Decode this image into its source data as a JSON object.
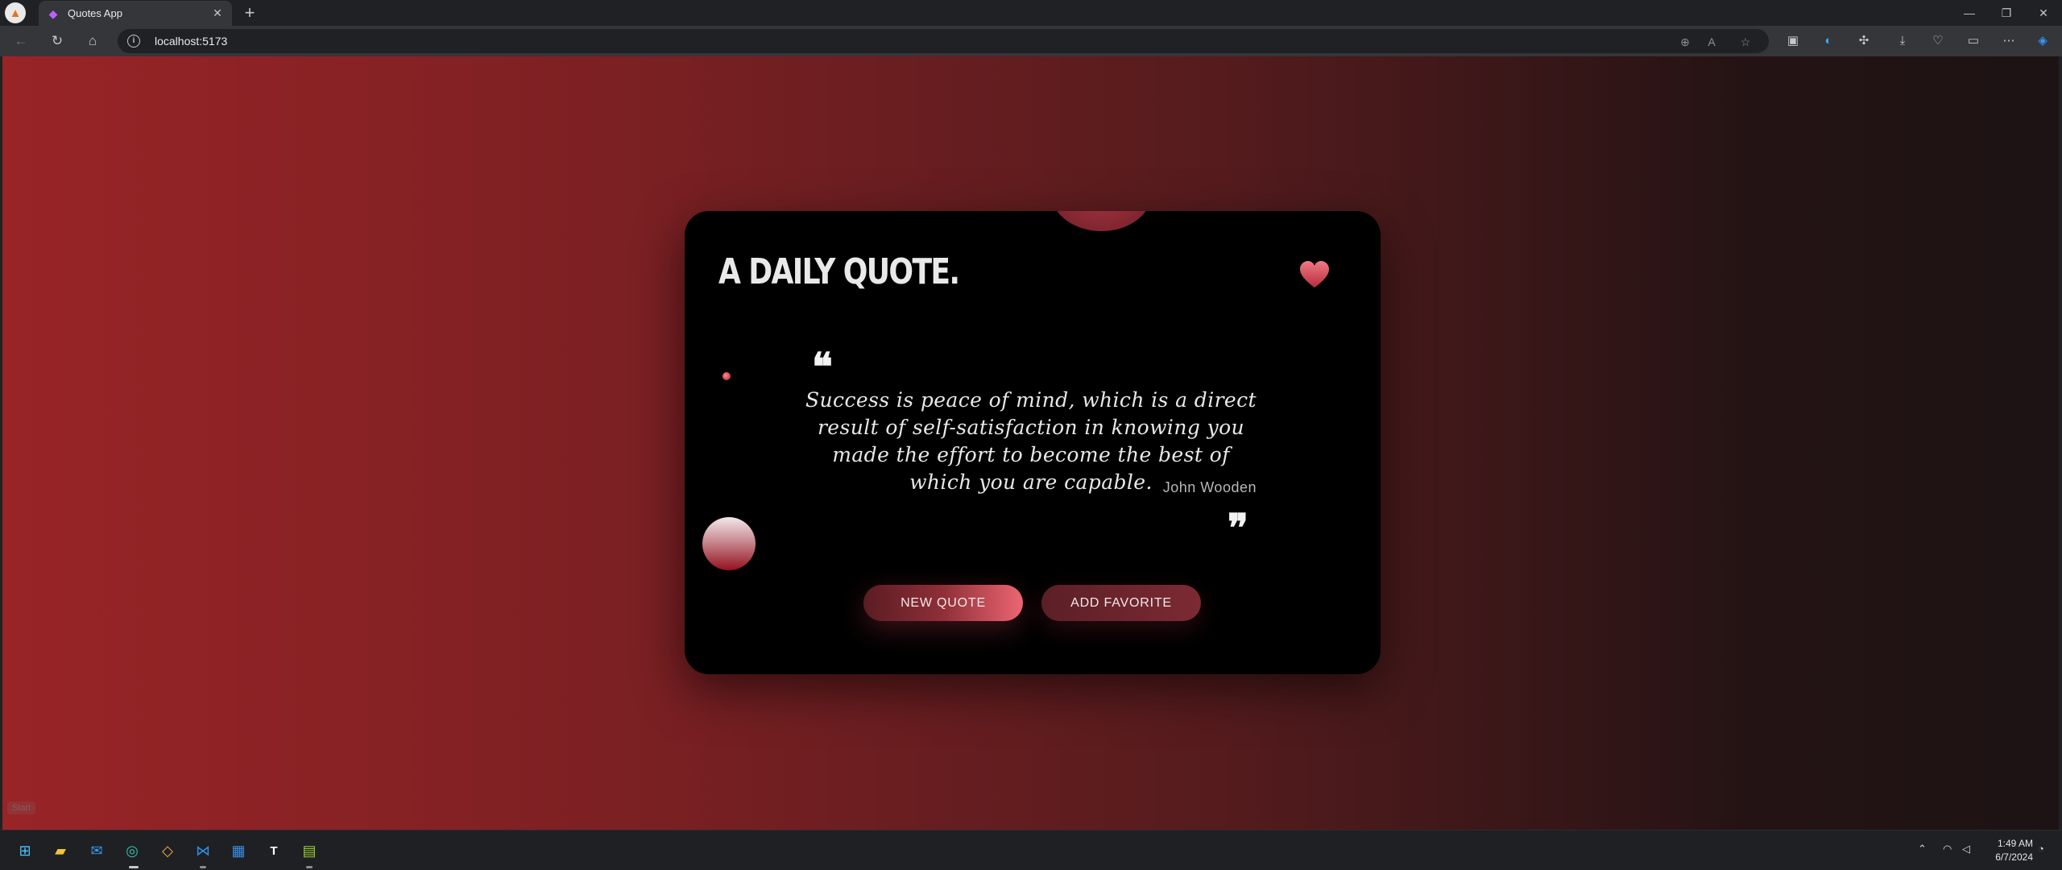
{
  "browser": {
    "tab": {
      "title": "Quotes App",
      "favicon": "vite-icon"
    },
    "address_bar": {
      "url": "localhost:5173"
    }
  },
  "page": {
    "start_tip": "Start",
    "card": {
      "title": "A DAILY QUOTE.",
      "quote": "Success is peace of mind, which is a direct result of self-satisfaction in knowing you made the effort to become the best of which you are capable.",
      "author": "John Wooden",
      "open_mark": "❝",
      "close_mark": "❞",
      "buttons": {
        "new_quote": "NEW QUOTE",
        "add_favorite": "ADD FAVORITE"
      }
    }
  },
  "taskbar": {
    "clock": {
      "time": "1:49 AM",
      "date": "6/7/2024"
    }
  },
  "colors": {
    "accent": "#e9535f",
    "card": "#000000",
    "bg_left": "#982426",
    "bg_right": "#1d1314"
  }
}
